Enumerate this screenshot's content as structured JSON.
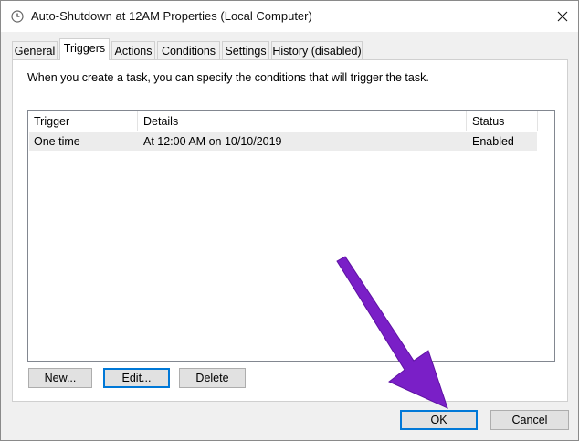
{
  "window": {
    "title": "Auto-Shutdown at 12AM Properties (Local Computer)"
  },
  "tabs": [
    {
      "label": "General"
    },
    {
      "label": "Triggers",
      "active": true
    },
    {
      "label": "Actions"
    },
    {
      "label": "Conditions"
    },
    {
      "label": "Settings"
    },
    {
      "label": "History (disabled)"
    }
  ],
  "triggers_tab": {
    "description": "When you create a task, you can specify the conditions that will trigger the task.",
    "table": {
      "columns": [
        "Trigger",
        "Details",
        "Status"
      ],
      "rows": [
        {
          "trigger": "One time",
          "details": "At 12:00 AM on 10/10/2019",
          "status": "Enabled"
        }
      ]
    },
    "buttons": {
      "new": "New...",
      "edit": "Edit...",
      "delete": "Delete"
    }
  },
  "footer": {
    "ok": "OK",
    "cancel": "Cancel"
  },
  "colors": {
    "annotation_arrow": "#7a1fc7",
    "focus_border": "#0078d7"
  },
  "icons": {
    "title": "clock-icon",
    "close": "close-icon",
    "annotation": "pointer-arrow-icon"
  }
}
